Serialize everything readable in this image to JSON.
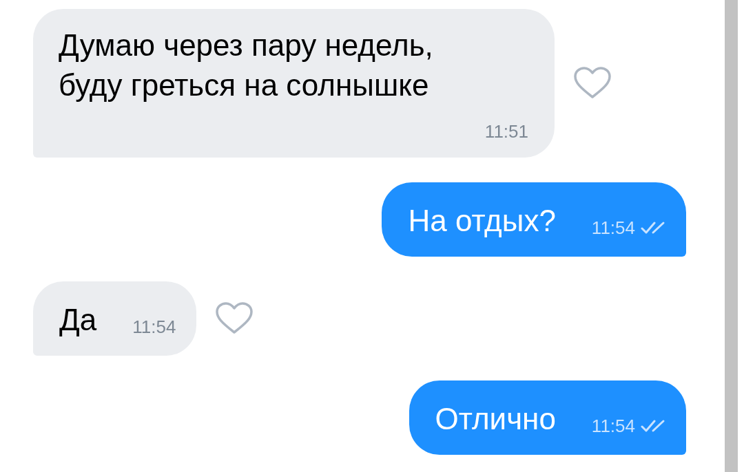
{
  "messages": [
    {
      "kind": "in",
      "lines": [
        "Думаю через пару недель,",
        "буду греться на солнышке"
      ],
      "time": "11:51",
      "liked": false
    },
    {
      "kind": "out",
      "lines": [
        "На отдых?"
      ],
      "time": "11:54",
      "read": true
    },
    {
      "kind": "in",
      "lines": [
        "Да"
      ],
      "time": "11:54",
      "liked": false
    },
    {
      "kind": "out",
      "lines": [
        "Отлично"
      ],
      "time": "11:54",
      "read": true
    }
  ]
}
